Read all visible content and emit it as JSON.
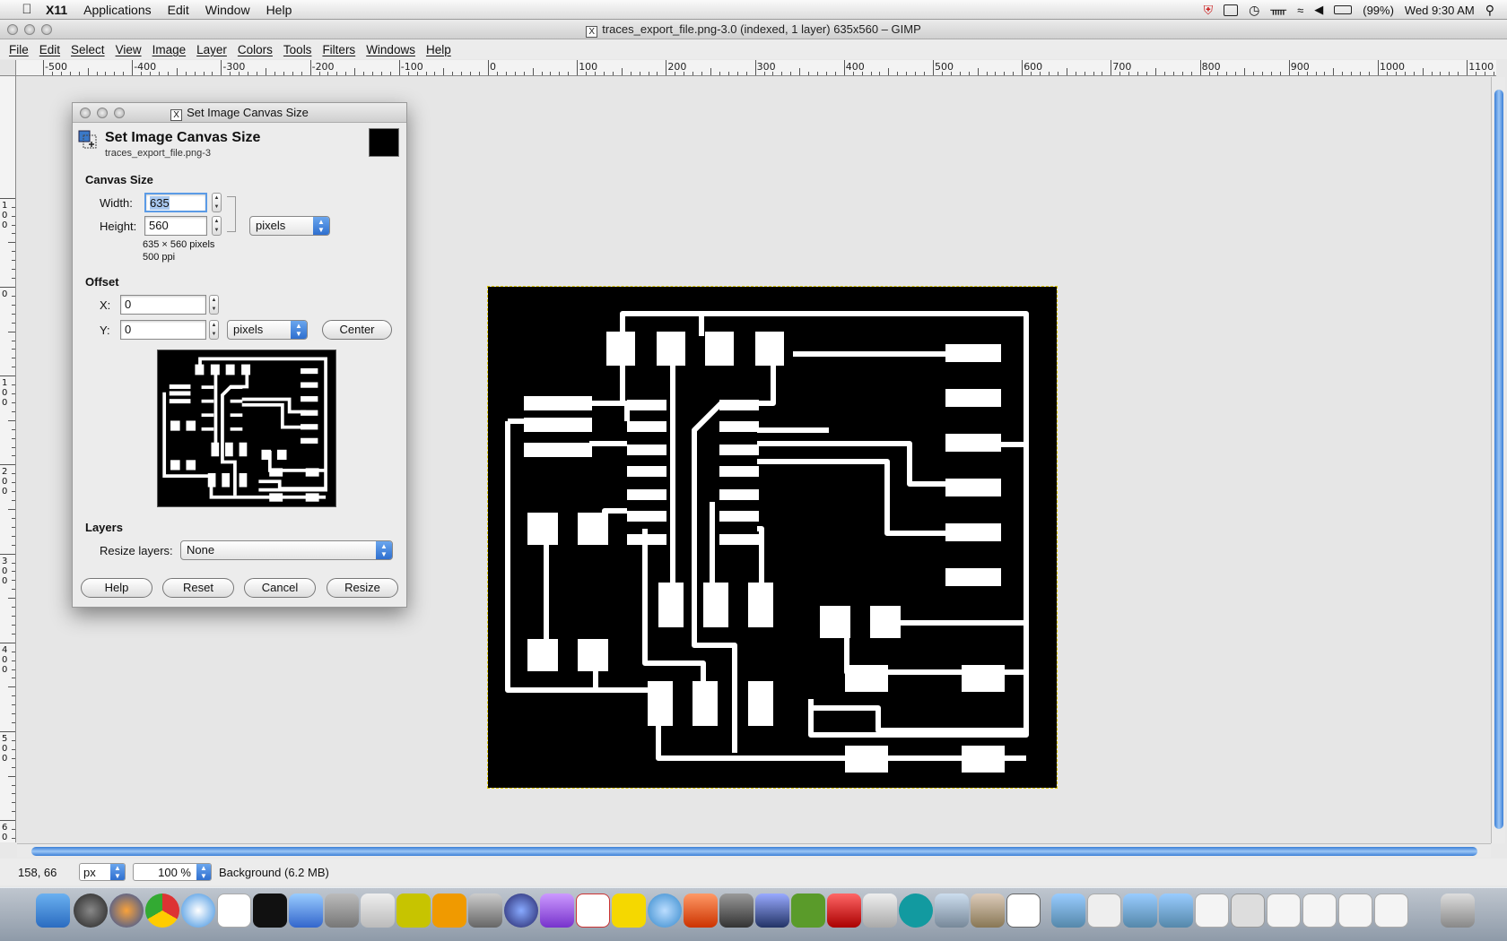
{
  "menubar": {
    "app_name": "X11",
    "items": [
      "Applications",
      "Edit",
      "Window",
      "Help"
    ],
    "battery": "(99%)",
    "clock": "Wed 9:30 AM"
  },
  "window": {
    "title": "traces_export_file.png-3.0 (indexed, 1 layer) 635x560 – GIMP"
  },
  "gimp_menu": [
    "File",
    "Edit",
    "Select",
    "View",
    "Image",
    "Layer",
    "Colors",
    "Tools",
    "Filters",
    "Windows",
    "Help"
  ],
  "hruler_labels": [
    "-500",
    "-400",
    "-300",
    "-200",
    "-100",
    "0",
    "100",
    "200",
    "300",
    "400",
    "500",
    "600",
    "700",
    "800",
    "900",
    "1000",
    "1100"
  ],
  "vruler_labels": [
    "100",
    "0",
    "100",
    "200",
    "300",
    "400",
    "500",
    "600"
  ],
  "dialog": {
    "window_title": "Set Image Canvas Size",
    "heading": "Set Image Canvas Size",
    "subtitle": "traces_export_file.png-3",
    "canvas_section": "Canvas Size",
    "width_label": "Width:",
    "width_value": "635",
    "height_label": "Height:",
    "height_value": "560",
    "size_unit": "pixels",
    "size_info": "635 × 560 pixels",
    "resolution_info": "500 ppi",
    "offset_section": "Offset",
    "x_label": "X:",
    "x_value": "0",
    "y_label": "Y:",
    "y_value": "0",
    "offset_unit": "pixels",
    "center_button": "Center",
    "layers_section": "Layers",
    "resize_layers_label": "Resize layers:",
    "resize_layers_value": "None",
    "help_button": "Help",
    "reset_button": "Reset",
    "cancel_button": "Cancel",
    "resize_button": "Resize"
  },
  "statusbar": {
    "coords": "158, 66",
    "unit": "px",
    "zoom": "100 %",
    "layer_info": "Background (6.2 MB)"
  },
  "colors": {
    "accent": "#3a7fd6",
    "image_background": "#000000",
    "traces": "#ffffff"
  }
}
